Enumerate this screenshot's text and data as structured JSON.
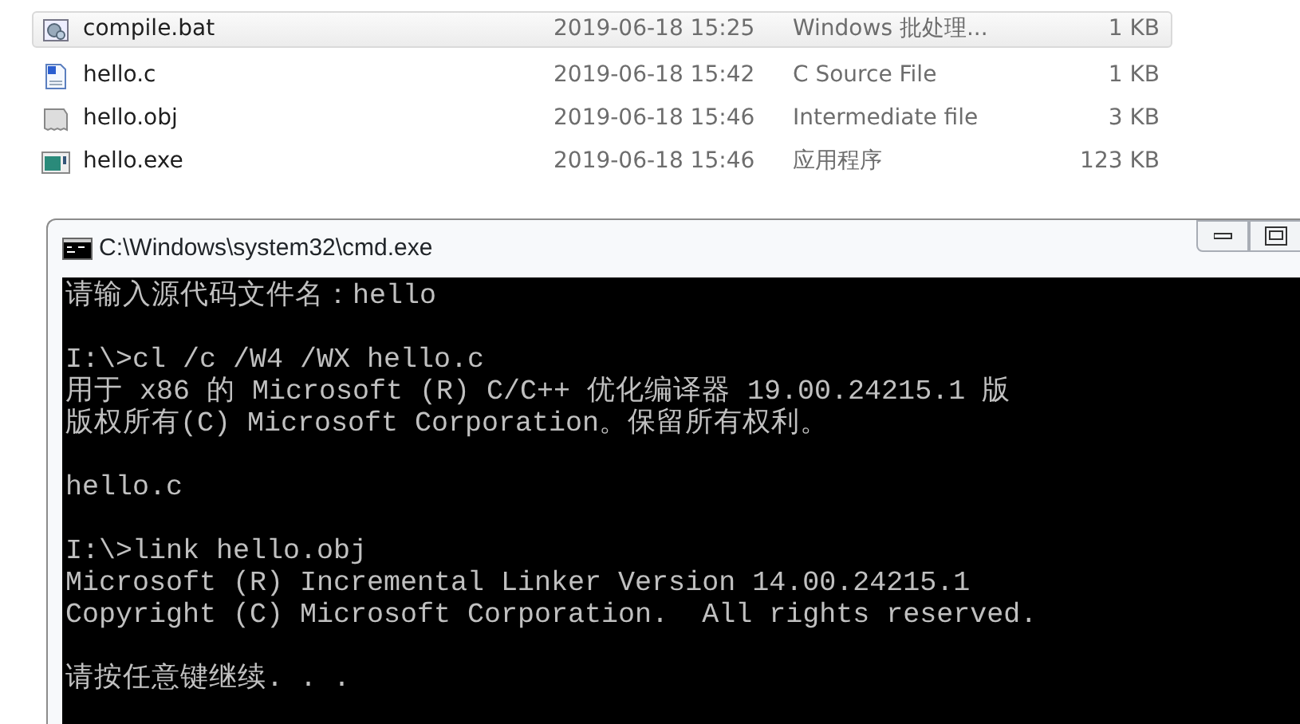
{
  "files": [
    {
      "name": "compile.bat",
      "modified": "2019-06-18 15:25",
      "type": "Windows 批处理...",
      "size": "1 KB",
      "kind": "bat",
      "selected": true
    },
    {
      "name": "hello.c",
      "modified": "2019-06-18 15:42",
      "type": "C Source File",
      "size": "1 KB",
      "kind": "c",
      "selected": false
    },
    {
      "name": "hello.obj",
      "modified": "2019-06-18 15:46",
      "type": "Intermediate file",
      "size": "3 KB",
      "kind": "obj",
      "selected": false
    },
    {
      "name": "hello.exe",
      "modified": "2019-06-18 15:46",
      "type": "应用程序",
      "size": "123 KB",
      "kind": "exe",
      "selected": false
    }
  ],
  "console_window": {
    "title": "C:\\Windows\\system32\\cmd.exe",
    "blocks": [
      [
        "请输入源代码文件名：hello"
      ],
      [
        "I:\\>cl /c /W4 /WX hello.c",
        "用于 x86 的 Microsoft (R) C/C++ 优化编译器 19.00.24215.1 版",
        "版权所有(C) Microsoft Corporation。保留所有权利。"
      ],
      [
        "hello.c"
      ],
      [
        "I:\\>link hello.obj",
        "Microsoft (R) Incremental Linker Version 14.00.24215.1",
        "Copyright (C) Microsoft Corporation.  All rights reserved."
      ],
      [
        "请按任意键继续. . ."
      ]
    ]
  }
}
